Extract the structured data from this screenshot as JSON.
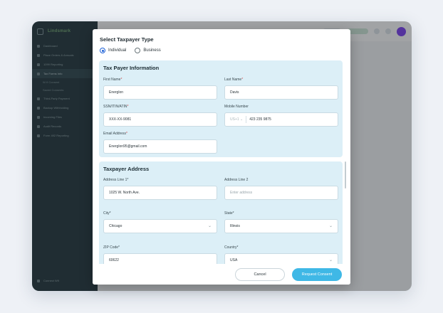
{
  "sidebar": {
    "logo": "Lindsmark",
    "items": [
      {
        "label": "Dashboard"
      },
      {
        "label": "Place Orders & Annuals"
      },
      {
        "label": "1099 Reporting"
      },
      {
        "label": "Tax Forms Info"
      }
    ],
    "subitems": [
      {
        "label": "W-9 Consent"
      },
      {
        "label": "Saved Consents"
      }
    ],
    "items2": [
      {
        "label": "Third-Party Payment"
      },
      {
        "label": "Backup Withholding"
      },
      {
        "label": "Incoming Files"
      },
      {
        "label": "Audit Records"
      },
      {
        "label": "Form 492 Reporting"
      }
    ],
    "bottom": "Connect W9"
  },
  "modal": {
    "type_title": "Select Taxpayer Type",
    "type_options": [
      "Individual",
      "Business"
    ],
    "type_selected": "Individual",
    "info_title": "Tax Payer Information",
    "first_name_label": "First Name",
    "first_name_value": "Energlon",
    "last_name_label": "Last Name",
    "last_name_value": "Davis",
    "ssn_label": "SSN/ITIN/ATIN",
    "ssn_value": "XXX-XX-9081",
    "mobile_label": "Mobile Number",
    "mobile_country": "US+1",
    "mobile_value": "423 235 9875",
    "email_label": "Email Address",
    "email_value": "Energlon95@gmail.com",
    "address_title": "Taxpayer Address",
    "addr1_label": "Address Line 1*",
    "addr1_value": "1025 W. North Ave.",
    "addr2_label": "Address Line 2",
    "addr2_placeholder": "Enter address",
    "city_label": "City*",
    "city_value": "Chicago",
    "state_label": "State*",
    "state_value": "Illinois",
    "zip_label": "ZIP Code*",
    "zip_value": "60622",
    "country_label": "Country*",
    "country_value": "USA",
    "required_mark": "*",
    "cancel_label": "Cancel",
    "submit_label": "Request Consent"
  },
  "colors": {
    "sidebar_bg": "#21353b",
    "panel_bg": "#dcefF7",
    "primary": "#3fb8e6",
    "radio": "#1c5fd6",
    "avatar": "#7a3ff2"
  }
}
